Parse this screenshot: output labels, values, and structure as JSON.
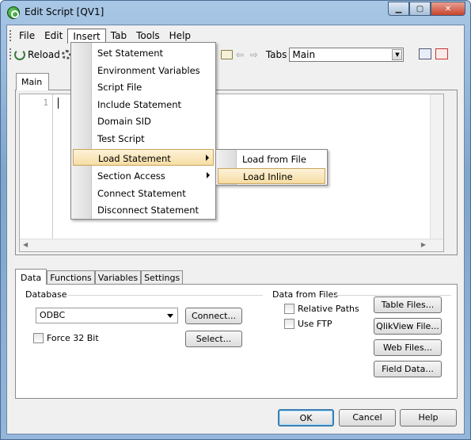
{
  "window": {
    "title": "Edit Script [QV1]",
    "min": "▁",
    "max": "▢",
    "close": "✕"
  },
  "menubar": {
    "items": [
      "File",
      "Edit",
      "Insert",
      "Tab",
      "Tools",
      "Help"
    ]
  },
  "toolbar": {
    "reload": "Reload",
    "tabs_label": "Tabs",
    "tabs_value": "Main"
  },
  "editor": {
    "tab": "Main",
    "line_number": "1"
  },
  "insert_menu": {
    "items": [
      "Set Statement",
      "Environment Variables",
      "Script File",
      "Include Statement",
      "Domain SID",
      "Test Script",
      "Load Statement",
      "Section Access",
      "Connect Statement",
      "Disconnect Statement"
    ],
    "highlighted": "Load Statement"
  },
  "load_submenu": {
    "items": [
      "Load from File",
      "Load Inline"
    ],
    "highlighted": "Load Inline"
  },
  "lower_tabs": [
    "Data",
    "Functions",
    "Variables",
    "Settings"
  ],
  "database": {
    "group_label": "Database",
    "selected": "ODBC",
    "connect": "Connect...",
    "select": "Select...",
    "force32": "Force 32 Bit"
  },
  "files": {
    "group_label": "Data from Files",
    "relative_paths": "Relative Paths",
    "use_ftp": "Use FTP",
    "table_files": "Table Files...",
    "qlikview_file": "QlikView File...",
    "web_files": "Web Files...",
    "field_data": "Field Data..."
  },
  "dialog": {
    "ok": "OK",
    "cancel": "Cancel",
    "help": "Help"
  }
}
